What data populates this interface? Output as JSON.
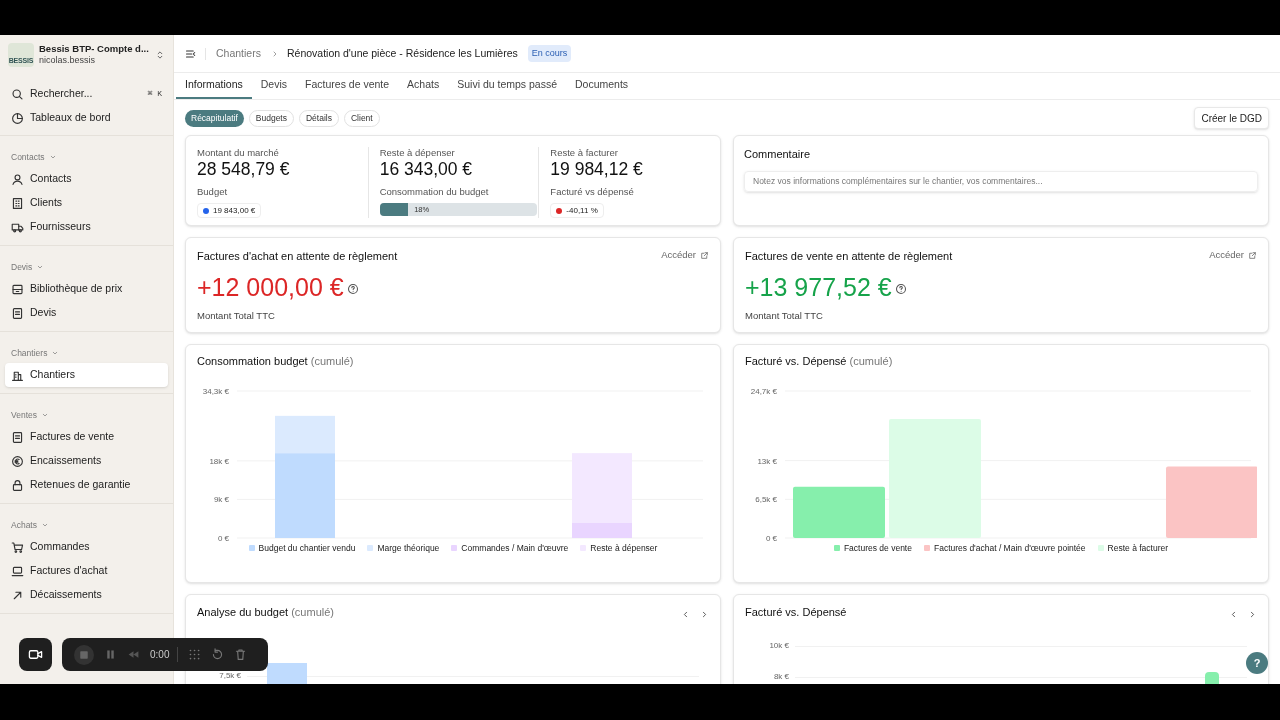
{
  "workspace": {
    "name": "Bessis BTP- Compte d...",
    "user": "nicolas.bessis",
    "logo": "BESSIS"
  },
  "sidebar": {
    "top_items": [
      {
        "kind": "search",
        "label": "Rechercher...",
        "shortcut": "⌘ K"
      },
      {
        "kind": "dashboard",
        "label": "Tableaux de bord"
      }
    ],
    "groups": [
      {
        "title": "Contacts",
        "items": [
          {
            "label": "Contacts",
            "selected": false
          },
          {
            "label": "Clients",
            "selected": false
          },
          {
            "label": "Fournisseurs",
            "selected": false
          }
        ]
      },
      {
        "title": "Devis",
        "items": [
          {
            "label": "Bibliothèque de prix",
            "selected": false
          },
          {
            "label": "Devis",
            "selected": false
          }
        ]
      },
      {
        "title": "Chantiers",
        "items": [
          {
            "label": "Chantiers",
            "selected": true
          }
        ]
      },
      {
        "title": "Ventes",
        "items": [
          {
            "label": "Factures de vente",
            "selected": false
          },
          {
            "label": "Encaissements",
            "selected": false
          },
          {
            "label": "Retenues de garantie",
            "selected": false
          }
        ]
      },
      {
        "title": "Achats",
        "items": [
          {
            "label": "Commandes",
            "selected": false
          },
          {
            "label": "Factures d'achat",
            "selected": false
          },
          {
            "label": "Décaissements",
            "selected": false
          }
        ]
      }
    ]
  },
  "header": {
    "breadcrumb": "Chantiers",
    "title": "Rénovation d'une pièce - Résidence les Lumières",
    "status": "En cours"
  },
  "tabs": [
    {
      "label": "Informations",
      "selected": true
    },
    {
      "label": "Devis",
      "selected": false
    },
    {
      "label": "Factures de vente",
      "selected": false
    },
    {
      "label": "Achats",
      "selected": false
    },
    {
      "label": "Suivi du temps passé",
      "selected": false
    },
    {
      "label": "Documents",
      "selected": false
    }
  ],
  "subtabs": [
    {
      "label": "Récapitulatif",
      "selected": true
    },
    {
      "label": "Budgets",
      "selected": false
    },
    {
      "label": "Détails",
      "selected": false
    },
    {
      "label": "Client",
      "selected": false
    }
  ],
  "action_button": "Créer le DGD",
  "summary": [
    {
      "kind": "badge",
      "label": "Montant du marché",
      "value": "28 548,79 €",
      "sublabel": "Budget",
      "badge": "19 843,00 €",
      "color": "#2563eb"
    },
    {
      "kind": "progress",
      "label": "Reste à dépenser",
      "value": "16 343,00 €",
      "sublabel": "Consommation du budget",
      "level": 0.18,
      "reading": "18%"
    },
    {
      "kind": "badge",
      "label": "Reste à facturer",
      "value": "19 984,12 €",
      "sublabel": "Facturé vs dépensé",
      "badge": "-40,11 %",
      "color": "#dc2626"
    }
  ],
  "comment": {
    "title": "Commentaire",
    "placeholder": "Notez vos informations complémentaires sur le chantier, vos commentaires..."
  },
  "pending": [
    {
      "title": "Factures d'achat en attente de règlement",
      "link": "Accéder",
      "amount": "+12 000,00 €",
      "color": "#dc2626",
      "caption": "Montant Total TTC"
    },
    {
      "title": "Factures de vente en attente de règlement",
      "link": "Accéder",
      "amount": "+13 977,52 €",
      "color": "#16a34a",
      "caption": "Montant Total TTC"
    }
  ],
  "charts": [
    {
      "title": "Consommation budget",
      "suffix": "(cumulé)",
      "chart_data": {
        "type": "bar",
        "stacked": true,
        "ylim": [
          0,
          34300
        ],
        "yticks": [
          {
            "value": 0,
            "label": "0 €"
          },
          {
            "value": 9000,
            "label": "9k €"
          },
          {
            "value": 18000,
            "label": "18k €"
          },
          {
            "value": 34300,
            "label": "34,3k €"
          }
        ],
        "series": [
          {
            "name": "Budget du chantier vendu",
            "color": "#bfdbfe",
            "values": [
              19800,
              null
            ]
          },
          {
            "name": "Marge théorique",
            "color": "#dbeafe",
            "values": [
              8700,
              null
            ]
          },
          {
            "name": "Commandes / Main d'œuvre",
            "color": "#e9d5ff",
            "values": [
              null,
              3500
            ]
          },
          {
            "name": "Reste à dépenser",
            "color": "#f3e8ff",
            "values": [
              null,
              16300
            ]
          }
        ]
      }
    },
    {
      "title": "Facturé vs. Dépensé",
      "suffix": "(cumulé)",
      "chart_data": {
        "type": "bar",
        "stacked": false,
        "ylim": [
          0,
          24700
        ],
        "yticks": [
          {
            "value": 0,
            "label": "0 €"
          },
          {
            "value": 6500,
            "label": "6,5k €"
          },
          {
            "value": 13000,
            "label": "13k €"
          },
          {
            "value": 24700,
            "label": "24,7k €"
          }
        ],
        "series": [
          {
            "name": "Factures de vente",
            "color": "#86efac",
            "values": [
              8600,
              null
            ]
          },
          {
            "name": "Factures d'achat / Main d'œuvre pointée",
            "color": "#fbc4c4",
            "values": [
              null,
              12000
            ]
          },
          {
            "name": "Reste à facturer",
            "color": "#dcfce7",
            "values": [
              20000,
              null
            ]
          }
        ]
      }
    }
  ],
  "bottom_cards": [
    {
      "title": "Analyse du budget",
      "suffix": "(cumulé)",
      "tick_labels": [
        "7,5k €"
      ]
    },
    {
      "title": "Facturé vs. Dépensé",
      "tick_labels": [
        "10k €",
        "8k €"
      ]
    }
  ],
  "recorder": {
    "time": "0:00"
  },
  "help": "?"
}
